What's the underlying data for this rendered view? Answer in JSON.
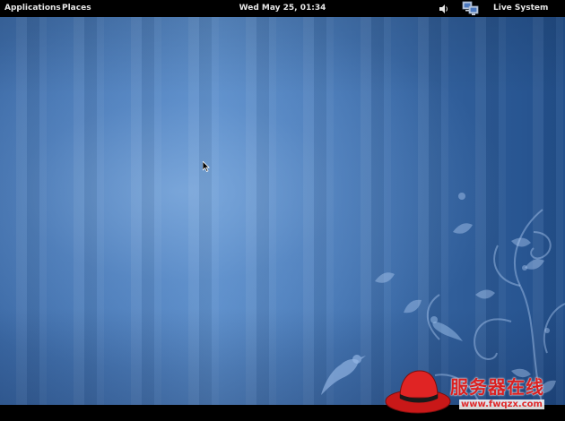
{
  "topbar": {
    "applications_label": "Applications",
    "places_label": "Places",
    "clock": "Wed May 25, 01:34",
    "user_label": "Live System User"
  },
  "tray": {
    "volume_icon": "volume-icon",
    "network_icon": "network-icon"
  },
  "watermark": {
    "title": "服务器在线",
    "url": "www.fwqzx.com"
  },
  "colors": {
    "topbar_bg": "#000000",
    "desktop_blue": "#4a7bb8",
    "watermark_red": "#d92020"
  }
}
